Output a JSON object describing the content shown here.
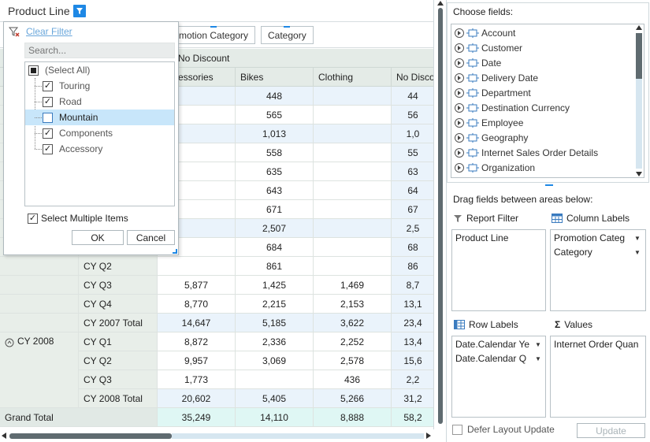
{
  "report_filter": {
    "field": "Product Line"
  },
  "column_chips": [
    {
      "label": "motion Category"
    },
    {
      "label": "Category"
    }
  ],
  "column_headers": {
    "top": "No Discount",
    "cols": [
      "essories",
      "Bikes",
      "Clothing",
      "No Disco"
    ]
  },
  "rows": [
    {
      "label": "",
      "v": [
        "",
        "448",
        "",
        "44"
      ]
    },
    {
      "label": "",
      "v": [
        "",
        "565",
        "",
        "56"
      ]
    },
    {
      "label": "",
      "v": [
        "",
        "1,013",
        "",
        "1,0"
      ]
    },
    {
      "label": "",
      "v": [
        "",
        "558",
        "",
        "55"
      ]
    },
    {
      "label": "",
      "v": [
        "",
        "635",
        "",
        "63"
      ]
    },
    {
      "label": "",
      "v": [
        "",
        "643",
        "",
        "64"
      ]
    },
    {
      "label": "",
      "v": [
        "",
        "671",
        "",
        "67"
      ]
    },
    {
      "label": "",
      "v": [
        "",
        "2,507",
        "",
        "2,5"
      ]
    },
    {
      "label": "",
      "v": [
        "",
        "684",
        "",
        "68"
      ]
    },
    {
      "label": "CY Q2",
      "v": [
        "",
        "861",
        "",
        "86"
      ]
    },
    {
      "label": "CY Q3",
      "v": [
        "5,877",
        "1,425",
        "1,469",
        "8,7"
      ]
    },
    {
      "label": "CY Q4",
      "v": [
        "8,770",
        "2,215",
        "2,153",
        "13,1"
      ]
    },
    {
      "label": "CY 2007 Total",
      "v": [
        "14,647",
        "5,185",
        "3,622",
        "23,4"
      ]
    },
    {
      "label": "CY Q1",
      "v": [
        "8,872",
        "2,336",
        "2,252",
        "13,4"
      ]
    },
    {
      "label": "CY Q2",
      "v": [
        "9,957",
        "3,069",
        "2,578",
        "15,6"
      ]
    },
    {
      "label": "CY Q3",
      "v": [
        "1,773",
        "",
        "436",
        "2,2"
      ]
    },
    {
      "label": "CY 2008 Total",
      "v": [
        "20,602",
        "5,405",
        "5,266",
        "31,2"
      ]
    }
  ],
  "year_group": {
    "label": "CY 2008"
  },
  "grand_total": {
    "label": "Grand Total",
    "v": [
      "35,249",
      "14,110",
      "8,888",
      "58,2"
    ]
  },
  "popup": {
    "clear_filter": "Clear Filter",
    "search_placeholder": "Search...",
    "items": [
      {
        "label": "(Select All)",
        "state": "partial"
      },
      {
        "label": "Touring",
        "state": "checked"
      },
      {
        "label": "Road",
        "state": "checked"
      },
      {
        "label": "Mountain",
        "state": "unchecked"
      },
      {
        "label": "Components",
        "state": "checked"
      },
      {
        "label": "Accessory",
        "state": "checked"
      }
    ],
    "multi_label": "Select Multiple Items",
    "ok": "OK",
    "cancel": "Cancel"
  },
  "field_list": {
    "title": "Choose fields:",
    "fields": [
      "Account",
      "Customer",
      "Date",
      "Delivery Date",
      "Department",
      "Destination Currency",
      "Employee",
      "Geography",
      "Internet Sales Order Details",
      "Organization"
    ]
  },
  "areas": {
    "title": "Drag fields between areas below:",
    "report_filter": {
      "label": "Report Filter",
      "items": [
        "Product Line"
      ]
    },
    "column_labels": {
      "label": "Column Labels",
      "items": [
        "Promotion Categ",
        "Category"
      ]
    },
    "row_labels": {
      "label": "Row Labels",
      "items": [
        "Date.Calendar Ye",
        "Date.Calendar Q"
      ]
    },
    "values": {
      "label": "Values",
      "items": [
        "Internet Order Quan"
      ]
    }
  },
  "defer_label": "Defer Layout Update",
  "update_label": "Update",
  "colors": {
    "accent": "#1e88e5",
    "header": "#e4ebe7",
    "alt_row": "#eaf3fb",
    "grand": "#dff7f4",
    "selected": "#c8e6fa"
  }
}
